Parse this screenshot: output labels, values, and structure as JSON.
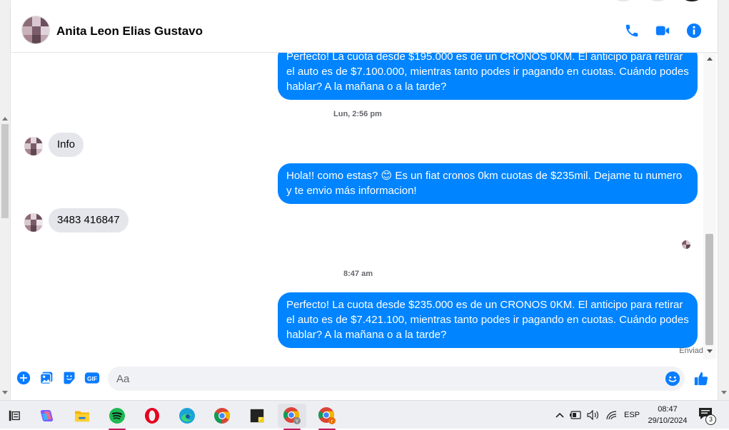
{
  "chat": {
    "contact_name": "Anita Leon Elias Gustavo",
    "header_icons": [
      "phone-icon",
      "video-call-icon",
      "info-icon"
    ]
  },
  "messages": [
    {
      "id": "m1",
      "direction": "out",
      "text": "Perfecto! La cuota desde $195.000 es de un CRONOS 0KM. El anticipo para retirar el auto es de $7.100.000, mientras tanto podes ir pagando en cuotas. Cuándo podes hablar? A la mañana o a la tarde?"
    },
    {
      "id": "t1",
      "type": "timestamp",
      "text": "Lun, 2:56 pm"
    },
    {
      "id": "m2",
      "direction": "in",
      "text": "Info"
    },
    {
      "id": "m3",
      "direction": "out",
      "text": "Hola!! como estas? 😊 Es un fiat cronos 0km cuotas de $235mil. Dejame tu numero y te envio más informacion!"
    },
    {
      "id": "m4",
      "direction": "in",
      "text": "3483 416847"
    },
    {
      "id": "t2",
      "type": "timestamp",
      "text": "8:47 am"
    },
    {
      "id": "m5",
      "direction": "out",
      "text": "Perfecto! La cuota desde $235.000 es de un CRONOS 0KM. El anticipo para retirar el auto es de $7.421.100, mientras tanto podes ir pagando en cuotas. Cuándo podes hablar? A la mañana o a la tarde?"
    }
  ],
  "status": {
    "sent_label": "Enviado"
  },
  "composer": {
    "placeholder": "Aa",
    "value": "",
    "icons": [
      "add-icon",
      "photo-icon",
      "sticker-icon",
      "gif-icon",
      "emoji-icon",
      "like-icon"
    ],
    "gif_label": "GIF"
  },
  "colors": {
    "accent": "#0084ff",
    "incoming_bubble": "#e4e6eb",
    "header_icon": "#0a7cff"
  },
  "taskbar": {
    "apps": [
      "task-view-icon",
      "copilot-icon",
      "file-explorer-icon",
      "spotify-icon",
      "opera-icon",
      "edge-icon",
      "chrome-icon",
      "sticky-notes-icon",
      "chrome-profile-y-icon",
      "chrome-profile-r-icon"
    ],
    "tray": {
      "language": "ESP",
      "time": "08:47",
      "date": "29/10/2024",
      "notification_count": "3"
    }
  }
}
